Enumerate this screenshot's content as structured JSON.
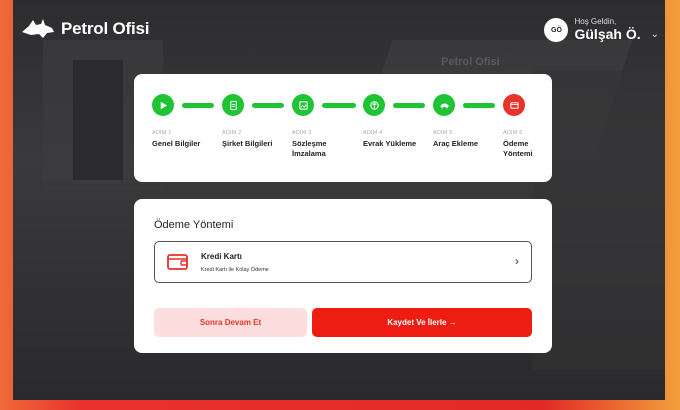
{
  "header": {
    "brand": "Petrol Ofisi",
    "background_brand": "Petrol Ofisi",
    "user": {
      "initials": "GÖ",
      "greeting": "Hoş Geldin,",
      "name": "Gülşah Ö."
    }
  },
  "steps": [
    {
      "num": "ADIM 1",
      "label": "Genel Bilgiler",
      "icon": "play-icon",
      "status": "done"
    },
    {
      "num": "ADIM 2",
      "label": "Şirket Bilgileri",
      "icon": "document-icon",
      "status": "done"
    },
    {
      "num": "ADIM 3",
      "label": "Sözleşme İmzalama",
      "icon": "signature-icon",
      "status": "done"
    },
    {
      "num": "ADIM 4",
      "label": "Evrak Yükleme",
      "icon": "upload-icon",
      "status": "done"
    },
    {
      "num": "ADIM 5",
      "label": "Araç Ekleme",
      "icon": "car-icon",
      "status": "done"
    },
    {
      "num": "ADIM 6",
      "label": "Ödeme Yöntemi",
      "icon": "wallet-icon",
      "status": "active"
    }
  ],
  "payment": {
    "title": "Ödeme Yöntemi",
    "option": {
      "name": "Kredi Kartı",
      "description": "Kredi Kartı ile Kolay Ödeme"
    }
  },
  "buttons": {
    "later": "Sonra Devam Et",
    "save": "Kaydet Ve İlerle →"
  },
  "colors": {
    "accent": "#e8322b",
    "success": "#1fc434"
  }
}
